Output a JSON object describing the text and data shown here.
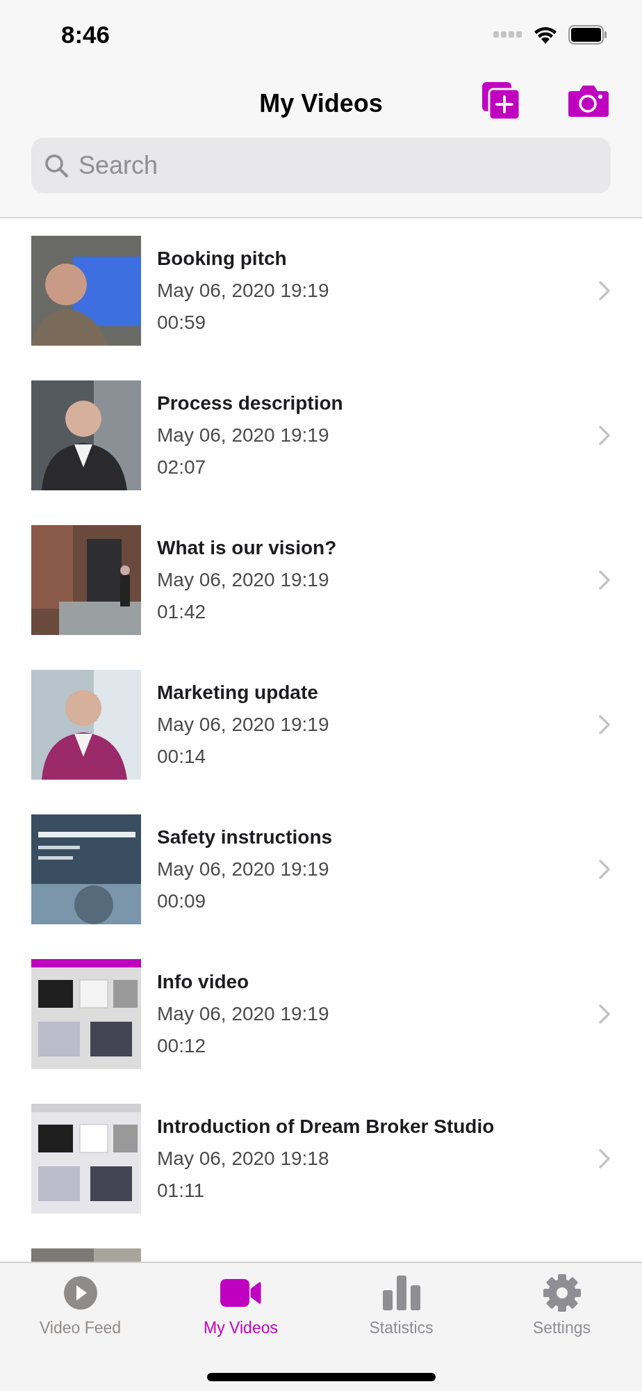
{
  "status_bar": {
    "time": "8:46"
  },
  "nav": {
    "title": "My Videos"
  },
  "search": {
    "placeholder": "Search"
  },
  "videos": [
    {
      "title": "Booking pitch",
      "date": "May 06, 2020 19:19",
      "duration": "00:59"
    },
    {
      "title": "Process description",
      "date": "May 06, 2020 19:19",
      "duration": "02:07"
    },
    {
      "title": "What is our vision?",
      "date": "May 06, 2020 19:19",
      "duration": "01:42"
    },
    {
      "title": "Marketing update",
      "date": "May 06, 2020 19:19",
      "duration": "00:14"
    },
    {
      "title": "Safety instructions",
      "date": "May 06, 2020 19:19",
      "duration": "00:09"
    },
    {
      "title": "Info video",
      "date": "May 06, 2020 19:19",
      "duration": "00:12"
    },
    {
      "title": "Introduction of Dream Broker Studio",
      "date": "May 06, 2020 19:18",
      "duration": "01:11"
    }
  ],
  "tabs": [
    {
      "kind": "play",
      "label": "Video Feed",
      "selected": false
    },
    {
      "kind": "camera",
      "label": "My Videos",
      "selected": true
    },
    {
      "kind": "chart",
      "label": "Statistics",
      "selected": false
    },
    {
      "kind": "gear",
      "label": "Settings",
      "selected": false
    }
  ]
}
